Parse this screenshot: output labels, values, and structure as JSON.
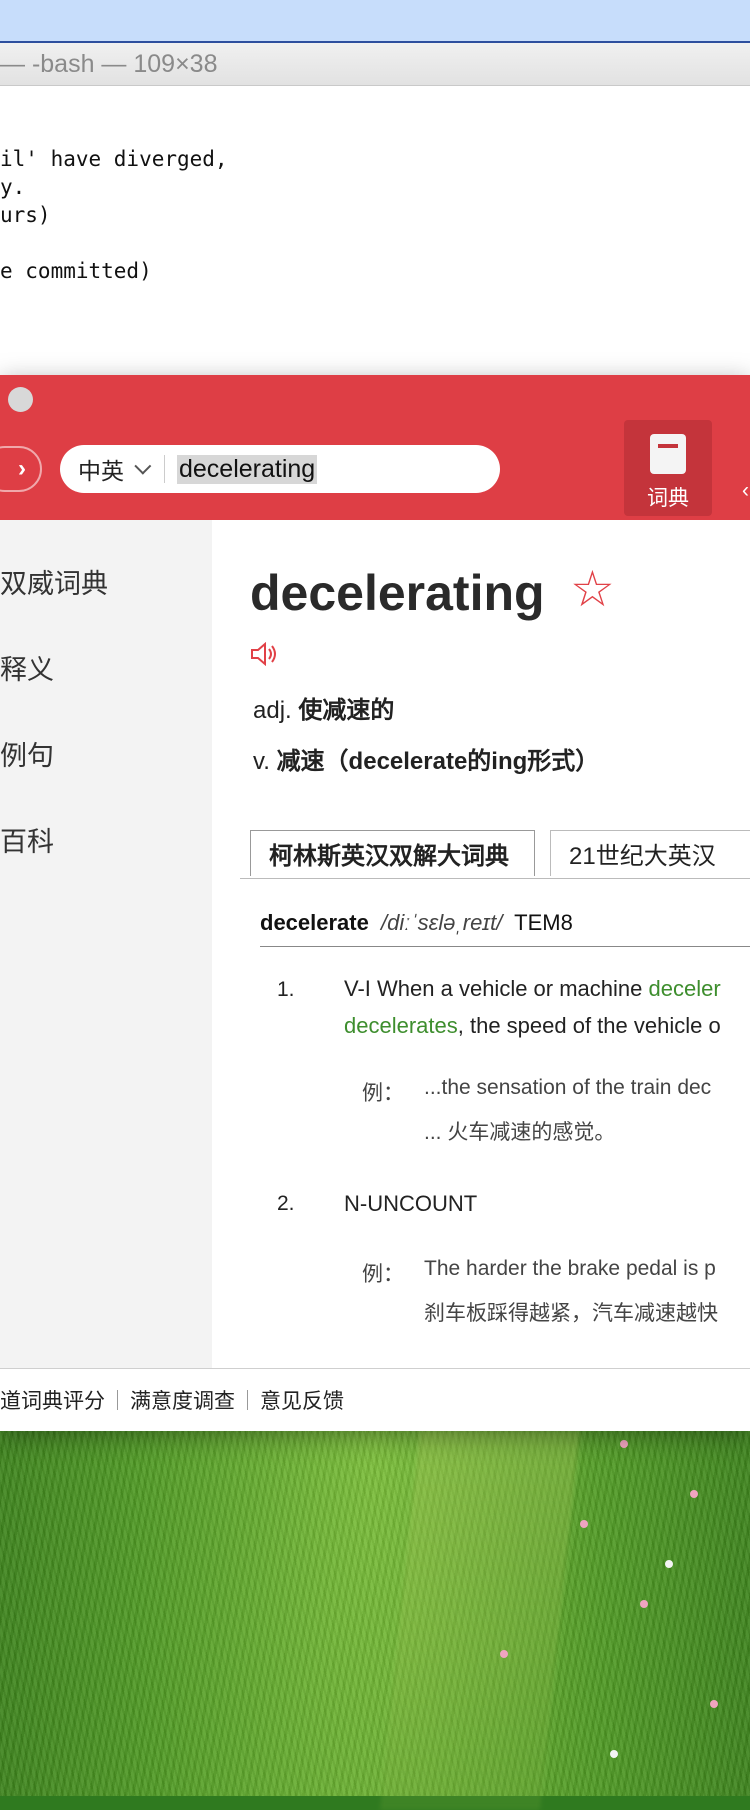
{
  "terminal": {
    "title": "— -bash — 109×38",
    "lines": [
      "il' have diverged,",
      "y.",
      "urs)",
      "",
      "e committed)"
    ]
  },
  "dictionary": {
    "header": {
      "forward_symbol": "›",
      "lang_select": "中英",
      "search_value": "decelerating",
      "tab_dict_label": "词典",
      "tab_next_label": "‹",
      "accent_color": "#de3e45"
    },
    "sidebar": {
      "items": [
        {
          "label": "双威词典"
        },
        {
          "label": "释义"
        },
        {
          "label": "例句"
        },
        {
          "label": "百科"
        }
      ]
    },
    "entry": {
      "word": "decelerating",
      "star_symbol": "☆",
      "definitions": [
        {
          "pos": "adj.",
          "meaning": "使减速的"
        },
        {
          "pos": "v.",
          "meaning": "减速（decelerate的ing形式）"
        }
      ],
      "source_tabs": [
        {
          "label": "柯林斯英汉双解大词典",
          "active": true
        },
        {
          "label": "21世纪大英汉",
          "active": false
        }
      ],
      "headword": "decelerate",
      "phonetic": "/diːˈsɛləˌreɪt/",
      "level": "TEM8",
      "senses": [
        {
          "num": "1.",
          "gram": "V-I",
          "text_a": "When a vehicle or machine",
          "green_a": "deceler",
          "green_b": "decelerates",
          "text_b": ", the speed of the vehicle o",
          "ex_label": "例：",
          "ex_en": "...the sensation of the train dec",
          "ex_zh": "... 火车减速的感觉。"
        },
        {
          "num": "2.",
          "gram": "N-UNCOUNT",
          "ex_label": "例：",
          "ex_en": "The harder the brake pedal is p",
          "ex_zh": "刹车板踩得越紧，汽车减速越快"
        }
      ]
    },
    "footer": {
      "links": [
        "道词典评分",
        "满意度调查",
        "意见反馈"
      ]
    }
  }
}
